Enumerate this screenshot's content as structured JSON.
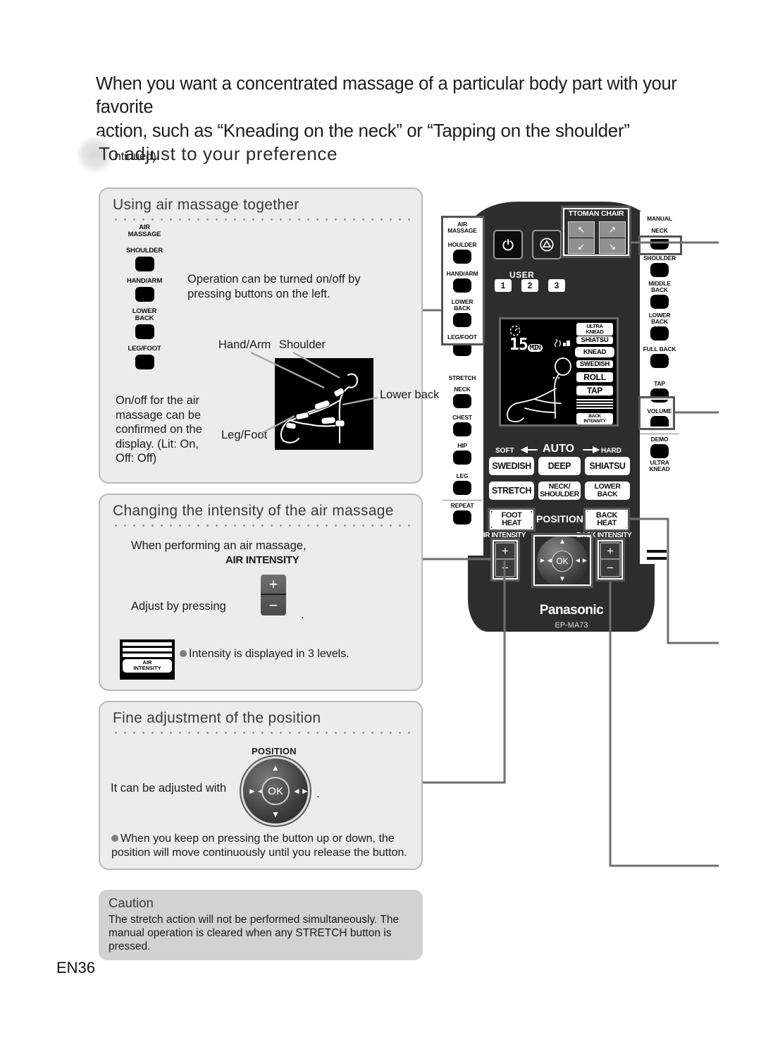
{
  "page": {
    "number": "EN36",
    "heading_line1": "When you want a concentrated massage of a particular body part with your favorite",
    "heading_line2a": "action, such as ",
    "heading_q1": "“Kneading on the neck”",
    "heading_mid": " or ",
    "heading_q2": "“Tapping on the shoulder”",
    "heading_cont": "(Continued)",
    "section_title": "To adjust to your preference"
  },
  "card_air": {
    "title": "Using air massage together",
    "buttons": [
      {
        "label_line1": "AIR",
        "label_line2": "MASSAGE",
        "has_key": false
      },
      {
        "label_line1": "SHOULDER",
        "label_line2": "",
        "has_key": true
      },
      {
        "label_line1": "HAND/ARM",
        "label_line2": "",
        "has_key": true
      },
      {
        "label_line1": "LOWER",
        "label_line2": "BACK",
        "has_key": true
      },
      {
        "label_line1": "LEG/FOOT",
        "label_line2": "",
        "has_key": true
      }
    ],
    "text_operation": "Operation can be turned on/off by pressing buttons on the left.",
    "text_onoff": "On/off for the air massage can be confirmed on the display. (Lit: On, Off: Off)",
    "callout_hand_arm": "Hand/Arm",
    "callout_shoulder": "Shoulder",
    "callout_lower_back": "Lower back",
    "callout_leg_foot": "Leg/Foot"
  },
  "card_intensity": {
    "title": "Changing the intensity of the air massage",
    "text_when": "When performing an air massage,",
    "air_intensity_caption": "AIR INTENSITY",
    "text_adjust": "Adjust by pressing",
    "plus": "+",
    "minus": "−",
    "period": ".",
    "icon_tag_line1": "AIR",
    "icon_tag_line2": "INTENSITY",
    "text_levels": "Intensity is displayed in 3 levels."
  },
  "card_position": {
    "title": "Fine adjustment of the position",
    "position_caption": "POSITION",
    "text_adjust": "It can be adjusted with",
    "ok_label": "OK",
    "period": ".",
    "text_keep": "When you keep on pressing the button up or down, the position will move continuously until you release the button."
  },
  "caution": {
    "title": "Caution",
    "body": "The stretch action will not be performed simultaneously. The manual operation is cleared when any STRETCH button is pressed."
  },
  "remote": {
    "brand": "Panasonic",
    "model": "EP-MA73",
    "air_massage_group": {
      "header_line1": "AIR",
      "header_line2": "MASSAGE",
      "keys": [
        {
          "label_line1": "HOULDER",
          "label_line2": ""
        },
        {
          "label_line1": "HAND/ARM",
          "label_line2": ""
        },
        {
          "label_line1": "LOWER",
          "label_line2": "BACK"
        },
        {
          "label_line1": "LEG/FOOT",
          "label_line2": ""
        }
      ]
    },
    "stretch_group": {
      "header": "STRETCH",
      "keys": [
        {
          "label": "NECK"
        },
        {
          "label": "CHEST"
        },
        {
          "label": "HIP"
        },
        {
          "label": "LEG"
        },
        {
          "label": "REPEAT"
        }
      ]
    },
    "manual_group": {
      "header": "MANUAL",
      "keys": [
        {
          "label_line1": "NECK",
          "label_line2": ""
        },
        {
          "label_line1": "SHOULDER",
          "label_line2": ""
        },
        {
          "label_line1": "MIDDLE",
          "label_line2": "BACK"
        },
        {
          "label_line1": "LOWER",
          "label_line2": "BACK"
        },
        {
          "label_line1": "FULL BACK",
          "label_line2": ""
        },
        {
          "label_line1": "TAP",
          "label_line2": ""
        },
        {
          "label_line1": "VOLUME",
          "label_line2": ""
        },
        {
          "label_line1": "DEMO",
          "label_line2": ""
        },
        {
          "label_line1": "ULTRA",
          "label_line2": "KNEAD"
        }
      ]
    },
    "power_icon": "power-icon",
    "stop_icon": "stop-icon",
    "user_label": "USER",
    "user_buttons": [
      "1",
      "2",
      "3"
    ],
    "ottoman_chair": {
      "header": "TTOMAN  CHAIR",
      "ottoman_up": "↖",
      "ottoman_down": "↙",
      "chair_up": "↗",
      "chair_down": "↘"
    },
    "lcd": {
      "timer_value": "15",
      "timer_unit": "MIN",
      "tags": [
        "ULTRA KNEAD",
        "SHIATSU",
        "KNEAD",
        "SWEDISH",
        "ROLL",
        "TAP"
      ],
      "selected_tag": "KNEAD",
      "back_intensity_label": "BACK INTENSITY"
    },
    "auto_row": {
      "soft": "SOFT",
      "auto": "AUTO",
      "hard": "HARD"
    },
    "program_buttons": [
      {
        "label": "SWEDISH"
      },
      {
        "label": "DEEP"
      },
      {
        "label": "SHIATSU"
      },
      {
        "label": "STRETCH"
      },
      {
        "label_line1": "NECK/",
        "label_line2": "SHOULDER"
      },
      {
        "label": "LOWER BACK"
      }
    ],
    "heat_row": {
      "foot_heat_line1": "FOOT",
      "foot_heat_line2": "HEAT",
      "position": "POSITION",
      "back_heat_line1": "BACK",
      "back_heat_line2": "HEAT"
    },
    "intensity_row": {
      "air_intensity": "AIR INTENSITY",
      "back_intensity": "BACK INTENSITY",
      "plus": "+",
      "minus": "−",
      "ok": "OK"
    }
  }
}
